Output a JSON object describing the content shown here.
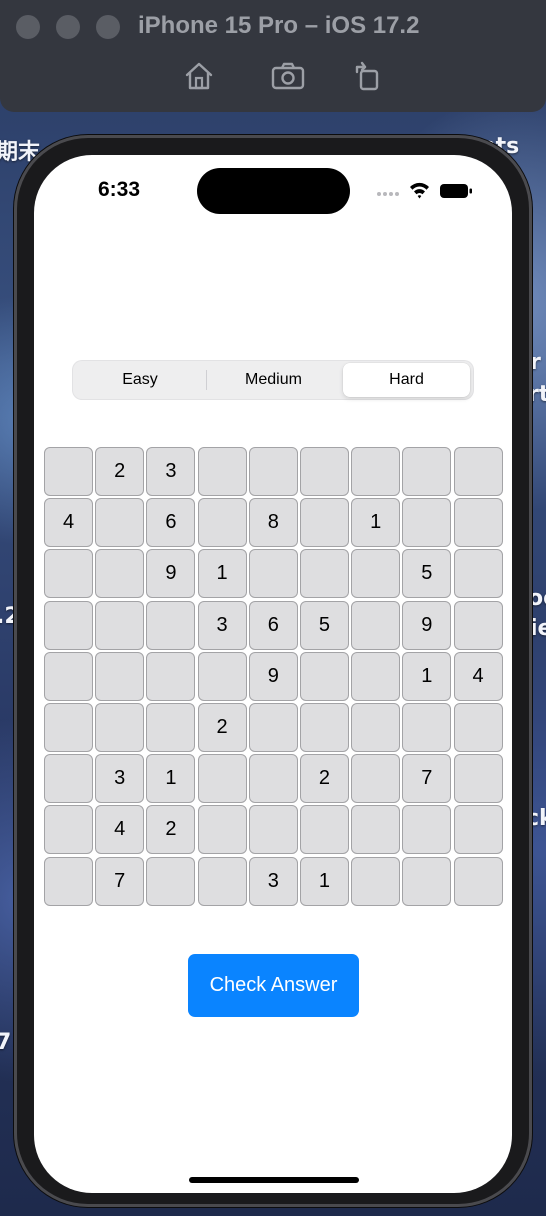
{
  "simulator": {
    "title": "iPhone 15 Pro – iOS 17.2",
    "toolbar_icons": [
      "home-icon",
      "screenshot-icon",
      "rotate-icon"
    ]
  },
  "desktop": {
    "fragments": [
      "期末",
      "nts",
      "r",
      "rt",
      "oo",
      "ie",
      "ck",
      ".2",
      "7"
    ]
  },
  "status_bar": {
    "time": "6:33",
    "icons": [
      "signal-dots-icon",
      "wifi-icon",
      "battery-icon"
    ]
  },
  "difficulty": {
    "options": [
      "Easy",
      "Medium",
      "Hard"
    ],
    "selected": "Hard"
  },
  "sudoku": {
    "rows": [
      [
        "",
        "2",
        "3",
        "",
        "",
        "",
        "",
        "",
        ""
      ],
      [
        "4",
        "",
        "6",
        "",
        "8",
        "",
        "1",
        "",
        ""
      ],
      [
        "",
        "",
        "9",
        "1",
        "",
        "",
        "",
        "5",
        ""
      ],
      [
        "",
        "",
        "",
        "3",
        "6",
        "5",
        "",
        "9",
        ""
      ],
      [
        "",
        "",
        "",
        "",
        "9",
        "",
        "",
        "1",
        "4"
      ],
      [
        "",
        "",
        "",
        "2",
        "",
        "",
        "",
        "",
        ""
      ],
      [
        "",
        "3",
        "1",
        "",
        "",
        "2",
        "",
        "7",
        ""
      ],
      [
        "",
        "4",
        "2",
        "",
        "",
        "",
        "",
        "",
        ""
      ],
      [
        "",
        "7",
        "",
        "",
        "3",
        "1",
        "",
        "",
        ""
      ]
    ]
  },
  "actions": {
    "check_label": "Check Answer",
    "accent_color": "#0a84ff"
  }
}
